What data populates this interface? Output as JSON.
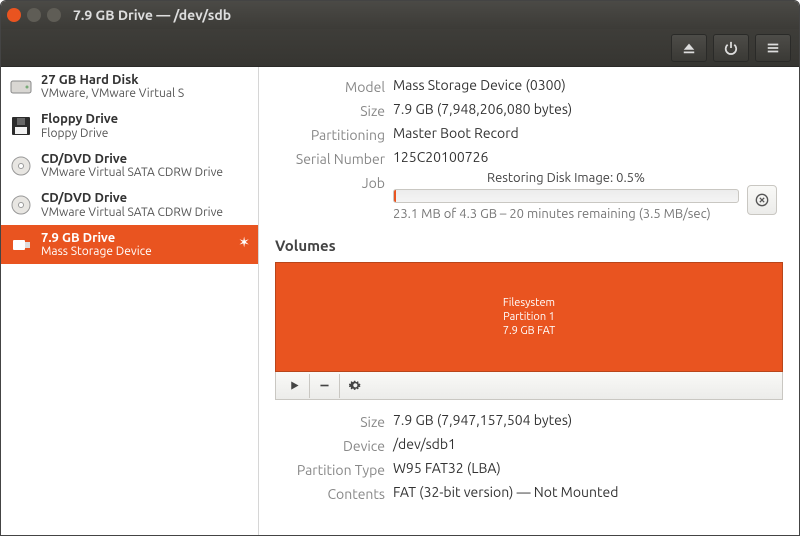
{
  "window_title": "7.9 GB Drive — /dev/sdb",
  "toolbar": {
    "eject_tip": "Eject",
    "power_tip": "Power off",
    "menu_tip": "Menu"
  },
  "drives": [
    {
      "title": "27 GB Hard Disk",
      "sub": "VMware, VMware Virtual S",
      "icon": "hdd"
    },
    {
      "title": "Floppy Drive",
      "sub": "Floppy Drive",
      "icon": "floppy"
    },
    {
      "title": "CD/DVD Drive",
      "sub": "VMware Virtual SATA CDRW Drive",
      "icon": "optical"
    },
    {
      "title": "CD/DVD Drive",
      "sub": "VMware Virtual SATA CDRW Drive",
      "icon": "optical"
    },
    {
      "title": "7.9 GB Drive",
      "sub": "Mass Storage Device",
      "icon": "usb"
    }
  ],
  "labels": {
    "model": "Model",
    "size": "Size",
    "partitioning": "Partitioning",
    "serial": "Serial Number",
    "job": "Job",
    "volumes_title": "Volumes",
    "vsize": "Size",
    "device": "Device",
    "ptype": "Partition Type",
    "contents": "Contents"
  },
  "info": {
    "model": "Mass Storage Device (0300)",
    "size": "7.9 GB (7,948,206,080 bytes)",
    "partitioning": "Master Boot Record",
    "serial": "125C20100726"
  },
  "job": {
    "title": "Restoring Disk Image: 0.5%",
    "progress_percent": 0.5,
    "status": "23.1 MB of 4.3 GB – 20 minutes remaining (3.5 MB/sec)"
  },
  "volume": {
    "line1": "Filesystem",
    "line2": "Partition 1",
    "line3": "7.9 GB FAT"
  },
  "vinfo": {
    "size": "7.9 GB (7,947,157,504 bytes)",
    "device": "/dev/sdb1",
    "ptype": "W95 FAT32 (LBA)",
    "contents": "FAT (32-bit version) — Not Mounted"
  }
}
